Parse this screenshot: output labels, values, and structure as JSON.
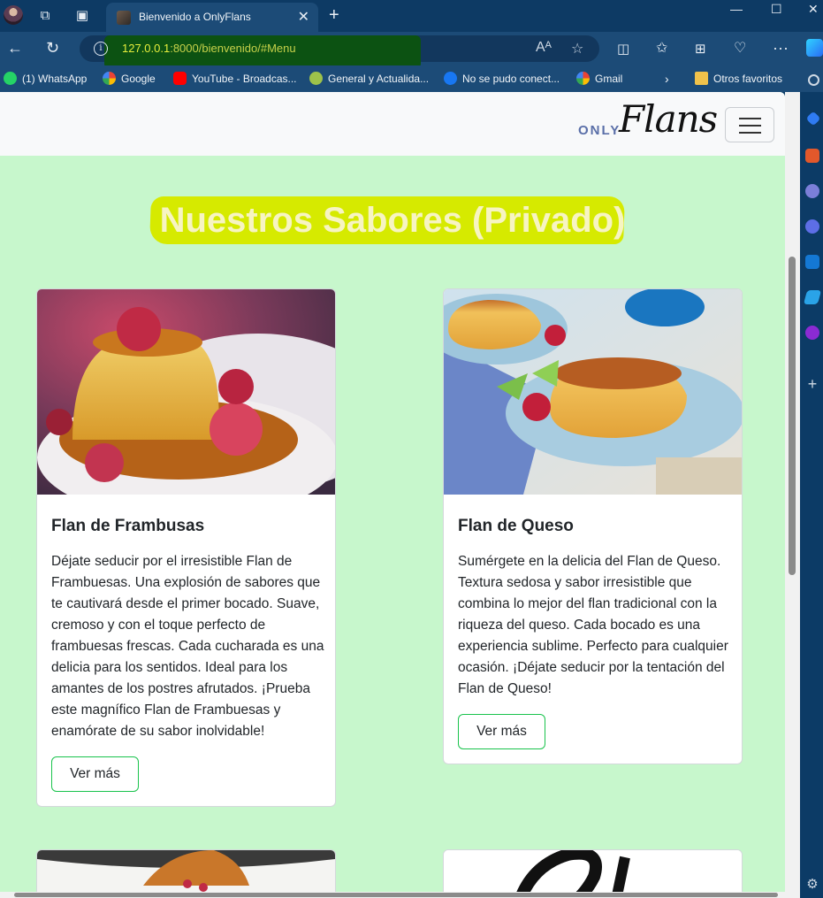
{
  "browser": {
    "tab_title": "Bienvenido a OnlyFlans",
    "url_host": "127.0.0.1",
    "url_rest": ":8000/bienvenido/#Menu",
    "bookmarks": [
      {
        "label": "(1) WhatsApp",
        "color": "#25d366"
      },
      {
        "label": "Google",
        "color": "#ffffff"
      },
      {
        "label": "YouTube - Broadcas...",
        "color": "#ff0000"
      },
      {
        "label": "General y Actualida...",
        "color": "#9ec24a"
      },
      {
        "label": "No se pudo conect...",
        "color": "#1877f2"
      },
      {
        "label": "Gmail",
        "color": "#ffffff"
      }
    ],
    "other_favorites": "Otros favoritos"
  },
  "navbar": {
    "brand_small": "ONLY",
    "brand_script": "Flans"
  },
  "hero": {
    "title": "Nuestros Sabores (Privado)"
  },
  "cards": [
    {
      "title": "Flan de Frambusas",
      "text": "Déjate seducir por el irresistible Flan de Frambuesas. Una explosión de sabores que te cautivará desde el primer bocado. Suave, cremoso y con el toque perfecto de frambuesas frescas. Cada cucharada es una delicia para los sentidos. Ideal para los amantes de los postres afrutados. ¡Prueba este magnífico Flan de Frambuesas y enamórate de su sabor inolvidable!",
      "button": "Ver más"
    },
    {
      "title": "Flan de Queso",
      "text": "Sumérgete en la delicia del Flan de Queso. Textura sedosa y sabor irresistible que combina lo mejor del flan tradicional con la riqueza del queso. Cada bocado es una experiencia sublime. Perfecto para cualquier ocasión. ¡Déjate seducir por la tentación del Flan de Queso!",
      "button": "Ver más"
    }
  ],
  "colors": {
    "page_background": "#c7f7cc",
    "hero_highlight": "#d6ea00",
    "button_border": "#19c34c"
  }
}
